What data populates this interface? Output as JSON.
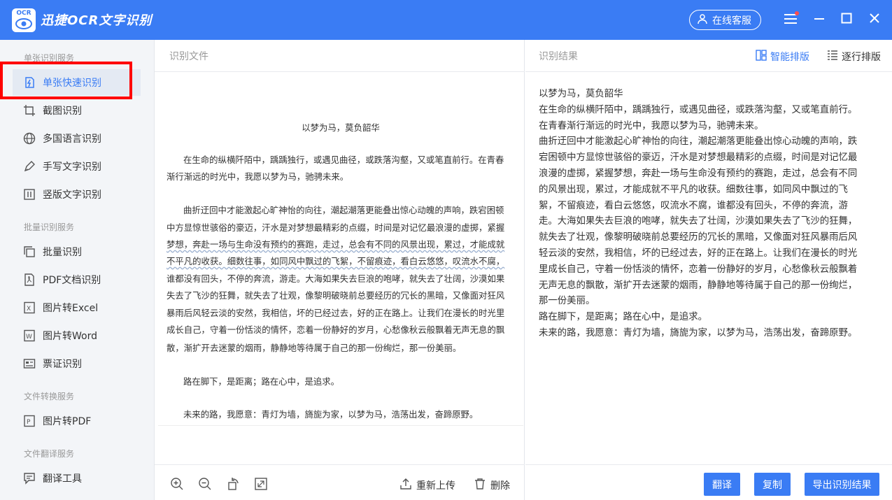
{
  "app": {
    "logo_text": "OCR",
    "title": "迅捷OCR文字识别",
    "service_label": "在线客服"
  },
  "sidebar": {
    "groups": [
      {
        "title": "单张识别服务"
      },
      {
        "title": "批量识别服务"
      },
      {
        "title": "文件转换服务"
      },
      {
        "title": "文件翻译服务"
      }
    ],
    "items": [
      {
        "label": "单张快速识别",
        "icon": "lightning-doc-icon"
      },
      {
        "label": "截图识别",
        "icon": "crop-icon"
      },
      {
        "label": "多国语言识别",
        "icon": "globe-icon"
      },
      {
        "label": "手写文字识别",
        "icon": "pen-icon"
      },
      {
        "label": "竖版文字识别",
        "icon": "vertical-text-icon"
      },
      {
        "label": "批量识别",
        "icon": "batch-icon"
      },
      {
        "label": "PDF文档识别",
        "icon": "pdf-icon"
      },
      {
        "label": "图片转Excel",
        "icon": "excel-icon"
      },
      {
        "label": "图片转Word",
        "icon": "word-icon"
      },
      {
        "label": "票证识别",
        "icon": "ticket-icon"
      },
      {
        "label": "图片转PDF",
        "icon": "pdf-convert-icon"
      },
      {
        "label": "翻译工具",
        "icon": "translate-icon"
      }
    ]
  },
  "left_panel": {
    "header": "识别文件",
    "doc_title": "以梦为马，莫负韶华",
    "doc_lines": [
      "在生命的纵横阡陌中，踽踽独行，或遇见曲径，或跌落沟壑，又或笔直前行。在青春",
      "渐行渐远的时光中，我愿以梦为马，驰骋未来。",
      "曲折迂回中才能激起心旷神怡的向往，潮起潮落更能叠出惊心动魄的声响，跌宕困顿",
      "中方显惊世骇俗的豪迈，汗水是对梦想最精彩的点缀，时间是对记忆最浪漫的虚掷，紧握",
      "梦想，奔赴一场与生命没有预约的赛跑，走过，总会有不同的风景出现，累过，才能成就",
      "不平凡的收获。细数往事，如同风中飘过的飞絮，不留痕迹，看白云悠悠，叹流水不腐，",
      "谁都没有回头，不停的奔流，游走。大海如果失去巨浪的咆哮，就失去了壮阔，沙漠如果",
      "失去了飞沙的狂舞，就失去了壮观，像黎明破晓前总要经历的冗长的黑暗，又像面对狂风",
      "暴雨后风轻云淡的安然，我相信，坏的已经过去，好的正在路上。让我们在漫长的时光里",
      "成长自己，守着一份恬淡的情怀，恋着一份静好的岁月，心愁像秋云般飘着无声无息的飘",
      "散，渐扩开去迷蒙的烟雨，静静地等待属于自己的那一份绚烂，那一份美丽。",
      "路在脚下，是距离；路在心中，是追求。",
      "未来的路，我愿意：青灯为墙，旖旎为家，以梦为马，浩荡出发，奋蹄原野。"
    ],
    "reupload_label": "重新上传",
    "delete_label": "删除"
  },
  "right_panel": {
    "header": "识别结果",
    "mode_smart": "智能排版",
    "mode_line": "逐行排版",
    "result_lines": [
      "以梦为马，莫负韶华",
      "在生命的纵横阡陌中，踽踽独行，或遇见曲径，或跌落沟壑，又或笔直前行。",
      "在青春渐行渐远的时光中，我愿以梦为马，驰骋未来。",
      "曲折迂回中才能激起心旷神怡的向往，潮起潮落更能叠出惊心动魄的声响，跌",
      "宕困顿中方显惊世骇俗的豪迈，汗水是对梦想最精彩的点缀，时间是对记忆最",
      "浪漫的虚掷，紧握梦想，奔赴一场与生命没有预约的赛跑，走过，总会有不同",
      "的风景出现，累过，才能成就不平凡的收获。细数往事，如同风中飘过的飞",
      "絮，不留痕迹，看白云悠悠，叹流水不腐，谁都没有回头，不停的奔流，游",
      "走。大海如果失去巨浪的咆哮，就失去了壮阔，沙漠如果失去了飞沙的狂舞，",
      "就失去了壮观，像黎明破晓前总要经历的冗长的黑暗，又像面对狂风暴雨后风",
      "轻云淡的安然，我相信，坏的已经过去，好的正在路上。让我们在漫长的时光",
      "里成长自己，守着一份恬淡的情怀，恋着一份静好的岁月，心愁像秋云般飘着",
      "无声无息的飘散，渐扩开去迷蒙的烟雨，静静地等待属于自己的那一份绚烂，",
      "那一份美丽。",
      "路在脚下，是距离；路在心中，是追求。",
      "未来的路，我愿意：青灯为墙，旖旎为家，以梦为马，浩荡出发，奋蹄原野。"
    ],
    "translate_label": "翻译",
    "copy_label": "复制",
    "export_label": "导出识别结果"
  },
  "colors": {
    "brand": "#3a7cf4",
    "highlight": "#ff0000",
    "sidebar_bg": "#f3f5f8"
  }
}
